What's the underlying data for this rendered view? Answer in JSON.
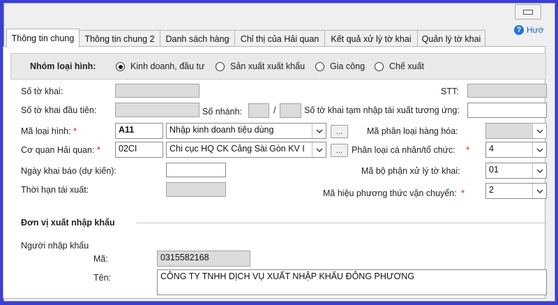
{
  "tabs": [
    {
      "label": "Thông tin chung"
    },
    {
      "label": "Thông tin chung 2"
    },
    {
      "label": "Danh sách hàng"
    },
    {
      "label": "Chỉ thị của Hải quan"
    },
    {
      "label": "Kết quả xử lý tờ khai"
    },
    {
      "label": "Quản lý tờ khai"
    }
  ],
  "help_label": "Hướ",
  "group": {
    "label": "Nhóm loại hình:",
    "options": [
      {
        "label": "Kinh doanh, đầu tư",
        "selected": true
      },
      {
        "label": "Sản xuất xuất khẩu",
        "selected": false
      },
      {
        "label": "Gia công",
        "selected": false
      },
      {
        "label": "Chế xuất",
        "selected": false
      }
    ]
  },
  "fields": {
    "so_to_khai": {
      "label": "Số tờ khai:",
      "value": ""
    },
    "stt": {
      "label": "STT:",
      "value": ""
    },
    "so_to_khai_dau_tien": {
      "label": "Số tờ khai đầu tiên:",
      "value": ""
    },
    "so_nhanh": {
      "label": "Số nhánh:",
      "value": "",
      "slash": "/",
      "value2": ""
    },
    "tam_nhap": {
      "label": "Số tờ khai tạm nhập tái xuất tương ứng:",
      "value": ""
    },
    "ma_loai_hinh": {
      "label": "Mã loại hình:",
      "required": "*",
      "code": "A11",
      "desc": "Nhập kinh doanh tiêu dùng"
    },
    "co_quan_hai_quan": {
      "label": "Cơ quan Hải quan:",
      "required": "*",
      "code": "02CI",
      "desc": "Chi cục HQ CK Cảng Sài Gòn KV I"
    },
    "ngay_khai_bao": {
      "label": "Ngày khai báo (dự kiến):",
      "value": ""
    },
    "thoi_han_tai_xuat": {
      "label": "Thời hạn tái xuất:",
      "value": ""
    },
    "ma_phan_loai_hang_hoa": {
      "label": "Mã phân loại hàng hóa:",
      "value": ""
    },
    "phan_loai_ca_nhan": {
      "label": "Phân loại cá nhân/tổ chức:",
      "required": "*",
      "value": "4"
    },
    "ma_bo_phan_xu_ly": {
      "label": "Mã bộ phận xử lý tờ khai:",
      "value": "01"
    },
    "ma_hieu_van_chuyen": {
      "label": "Mã hiệu phương thức vận chuyển:",
      "required": "*",
      "value": "2"
    }
  },
  "section": {
    "title": "Đơn vị xuất nhập khẩu",
    "importer_label": "Người nhập khẩu",
    "ma_label": "Mã:",
    "ma_value": "0315582168",
    "ten_label": "Tên:",
    "ten_value": "CÔNG TY TNHH DỊCH VỤ XUẤT NHẬP KHẨU ĐÔNG PHƯƠNG"
  },
  "more_button": "..."
}
